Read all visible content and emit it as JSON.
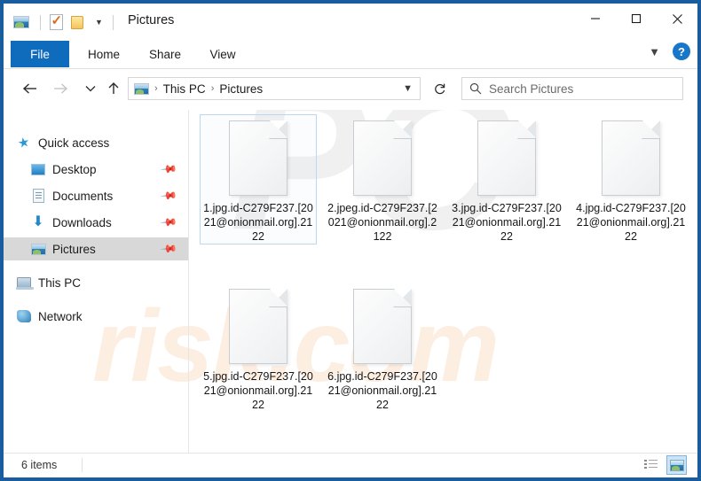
{
  "window": {
    "title": "Pictures",
    "border_color": "#1a5d9e",
    "controls": {
      "minimize": "minimize-icon",
      "maximize": "maximize-icon",
      "close": "close-icon"
    }
  },
  "quick_access_toolbar": {
    "items": [
      {
        "name": "pictures-icon",
        "icon": "pictures-icon"
      },
      {
        "name": "properties-icon",
        "icon": "properties-check-icon"
      },
      {
        "name": "new-folder-icon",
        "icon": "folder-icon"
      },
      {
        "name": "customize-dropdown",
        "icon": "caret-down-icon"
      }
    ]
  },
  "ribbon": {
    "tabs": [
      {
        "label": "File",
        "active": true
      },
      {
        "label": "Home",
        "active": false
      },
      {
        "label": "Share",
        "active": false
      },
      {
        "label": "View",
        "active": false
      }
    ],
    "file_tab_color": "#0f6cbd",
    "expand_icon": "chevron-down-icon",
    "help_label": "?"
  },
  "navigation": {
    "back_icon": "arrow-left-icon",
    "forward_icon": "arrow-right-icon",
    "recent_icon": "chevron-down-icon",
    "up_icon": "arrow-up-icon",
    "refresh_icon": "refresh-icon"
  },
  "breadcrumb": {
    "icon": "pictures-icon",
    "separator": "›",
    "items": [
      "This PC",
      "Pictures"
    ],
    "dropdown_icon": "chevron-down-icon"
  },
  "search": {
    "icon": "search-icon",
    "placeholder": "Search Pictures",
    "value": ""
  },
  "sidebar": {
    "items": [
      {
        "label": "Quick access",
        "icon": "star-icon",
        "indent": 14,
        "pinned": false,
        "selected": false
      },
      {
        "label": "Desktop",
        "icon": "desktop-icon",
        "indent": 30,
        "pinned": true,
        "selected": false
      },
      {
        "label": "Documents",
        "icon": "documents-icon",
        "indent": 30,
        "pinned": true,
        "selected": false
      },
      {
        "label": "Downloads",
        "icon": "downloads-icon",
        "indent": 30,
        "pinned": true,
        "selected": false
      },
      {
        "label": "Pictures",
        "icon": "pictures-icon",
        "indent": 30,
        "pinned": true,
        "selected": true
      },
      {
        "label": "This PC",
        "icon": "this-pc-icon",
        "indent": 14,
        "pinned": false,
        "selected": false
      },
      {
        "label": "Network",
        "icon": "network-icon",
        "indent": 14,
        "pinned": false,
        "selected": false
      }
    ],
    "selected_bg": "#d8d8d8"
  },
  "files": [
    {
      "name": "1.jpg.id-C279F237.[2021@onionmail.org].2122",
      "icon": "blank-document-icon",
      "selected": true
    },
    {
      "name": "2.jpeg.id-C279F237.[2021@onionmail.org].2122",
      "icon": "blank-document-icon",
      "selected": false
    },
    {
      "name": "3.jpg.id-C279F237.[2021@onionmail.org].2122",
      "icon": "blank-document-icon",
      "selected": false
    },
    {
      "name": "4.jpg.id-C279F237.[2021@onionmail.org].2122",
      "icon": "blank-document-icon",
      "selected": false
    },
    {
      "name": "5.jpg.id-C279F237.[2021@onionmail.org].2122",
      "icon": "blank-document-icon",
      "selected": false
    },
    {
      "name": "6.jpg.id-C279F237.[2021@onionmail.org].2122",
      "icon": "blank-document-icon",
      "selected": false
    }
  ],
  "status_bar": {
    "item_count": "6 items",
    "views": [
      {
        "name": "details-view",
        "active": false
      },
      {
        "name": "large-icons-view",
        "active": true
      }
    ]
  },
  "watermarks": {
    "primary": "PC",
    "secondary": "risk.com"
  }
}
